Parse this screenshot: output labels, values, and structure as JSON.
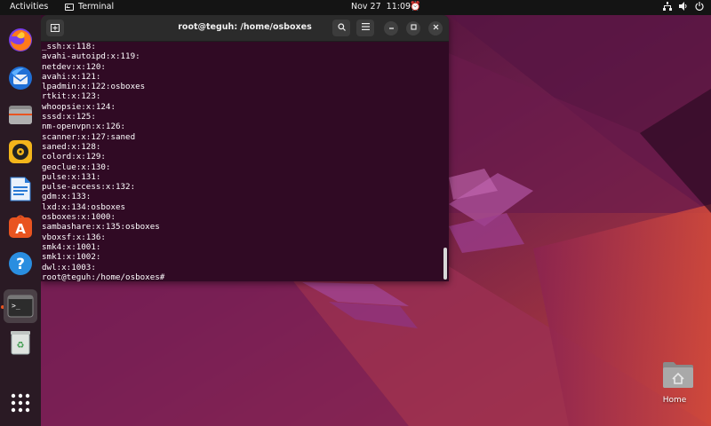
{
  "topbar": {
    "activities": "Activities",
    "app_name": "Terminal",
    "date": "Nov 27",
    "time": "11:09"
  },
  "dock": {
    "items": [
      {
        "name": "firefox-icon"
      },
      {
        "name": "thunderbird-icon"
      },
      {
        "name": "files-icon"
      },
      {
        "name": "rhythmbox-icon"
      },
      {
        "name": "libreoffice-writer-icon"
      },
      {
        "name": "app-center-icon"
      },
      {
        "name": "help-icon"
      },
      {
        "name": "terminal-icon"
      },
      {
        "name": "trash-icon"
      },
      {
        "name": "show-apps-icon"
      }
    ]
  },
  "terminal": {
    "title": "root@teguh: /home/osboxes",
    "lines": [
      "_ssh:x:118:",
      "avahi-autoipd:x:119:",
      "netdev:x:120:",
      "avahi:x:121:",
      "lpadmin:x:122:osboxes",
      "rtkit:x:123:",
      "whoopsie:x:124:",
      "sssd:x:125:",
      "nm-openvpn:x:126:",
      "scanner:x:127:saned",
      "saned:x:128:",
      "colord:x:129:",
      "geoclue:x:130:",
      "pulse:x:131:",
      "pulse-access:x:132:",
      "gdm:x:133:",
      "lxd:x:134:osboxes",
      "osboxes:x:1000:",
      "sambashare:x:135:osboxes",
      "vboxsf:x:136:",
      "smk4:x:1001:",
      "smk1:x:1002:",
      "dwl:x:1003:",
      "root@teguh:/home/osboxes#"
    ]
  },
  "desktop": {
    "home_label": "Home"
  },
  "colors": {
    "terminal_bg": "#300a24",
    "accent": "#e95420"
  }
}
